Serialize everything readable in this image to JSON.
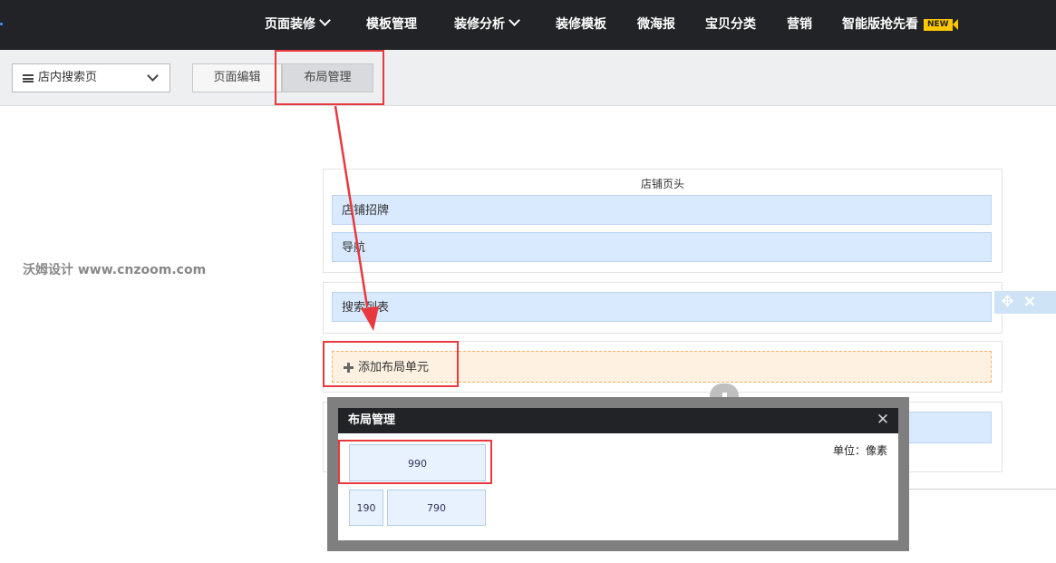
{
  "topnav": {
    "items": [
      {
        "label": "页面装修",
        "dropdown": true
      },
      {
        "label": "模板管理",
        "dropdown": false
      },
      {
        "label": "装修分析",
        "dropdown": true
      },
      {
        "label": "装修模板",
        "dropdown": false
      },
      {
        "label": "微海报",
        "dropdown": false
      },
      {
        "label": "宝贝分类",
        "dropdown": false
      },
      {
        "label": "营销",
        "dropdown": false
      },
      {
        "label": "智能版抢先看",
        "dropdown": false
      }
    ],
    "new_badge": "NEW"
  },
  "toolbar": {
    "page_select_value": "店内搜索页",
    "tabs": [
      {
        "label": "页面编辑",
        "active": false
      },
      {
        "label": "布局管理",
        "active": true
      }
    ]
  },
  "watermark": "沃姆设计 www.cnzoom.com",
  "canvas": {
    "header_section_title": "店铺页头",
    "header_units": [
      "店铺招牌",
      "导航"
    ],
    "list_unit": "搜索列表",
    "add_unit_label": "添加布局单元"
  },
  "modal": {
    "title": "布局管理",
    "unit_label": "单位：像素",
    "layouts": [
      "990",
      "190",
      "790"
    ]
  },
  "colors": {
    "nav_bg": "#222326",
    "unit_bg": "#d9eaff",
    "add_bg": "#fef1e2",
    "highlight": "#e8393f",
    "badge": "#ffc700"
  }
}
